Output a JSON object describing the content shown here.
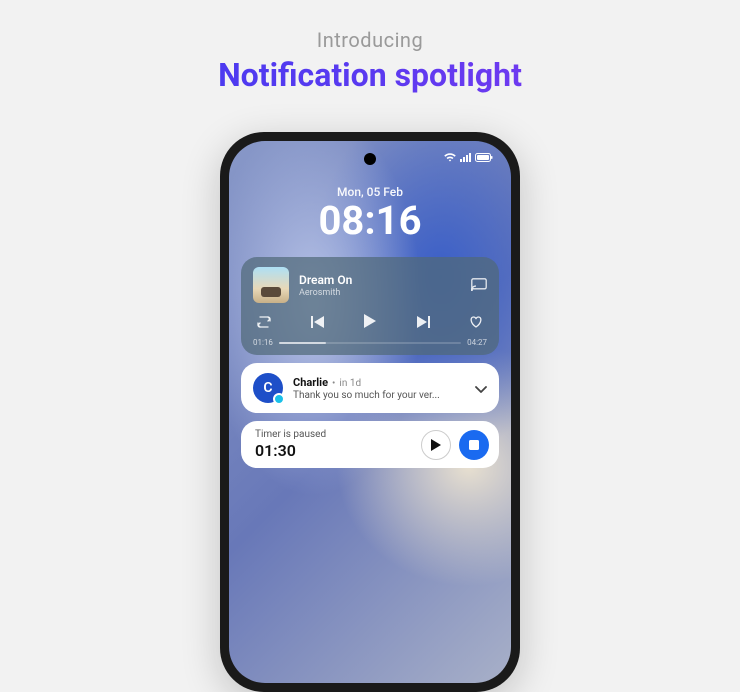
{
  "headline": {
    "intro": "Introducing",
    "title": "Notification spotlight"
  },
  "lockscreen": {
    "date": "Mon, 05 Feb",
    "time": "08:16"
  },
  "media": {
    "track_title": "Dream On",
    "track_artist": "Aerosmith",
    "elapsed": "01:16",
    "duration": "04:27"
  },
  "notification": {
    "avatar_initial": "C",
    "sender": "Charlie",
    "separator": "•",
    "time": "in 1d",
    "text": "Thank you so much for your ver..."
  },
  "timer": {
    "label": "Timer is paused",
    "value": "01:30"
  }
}
